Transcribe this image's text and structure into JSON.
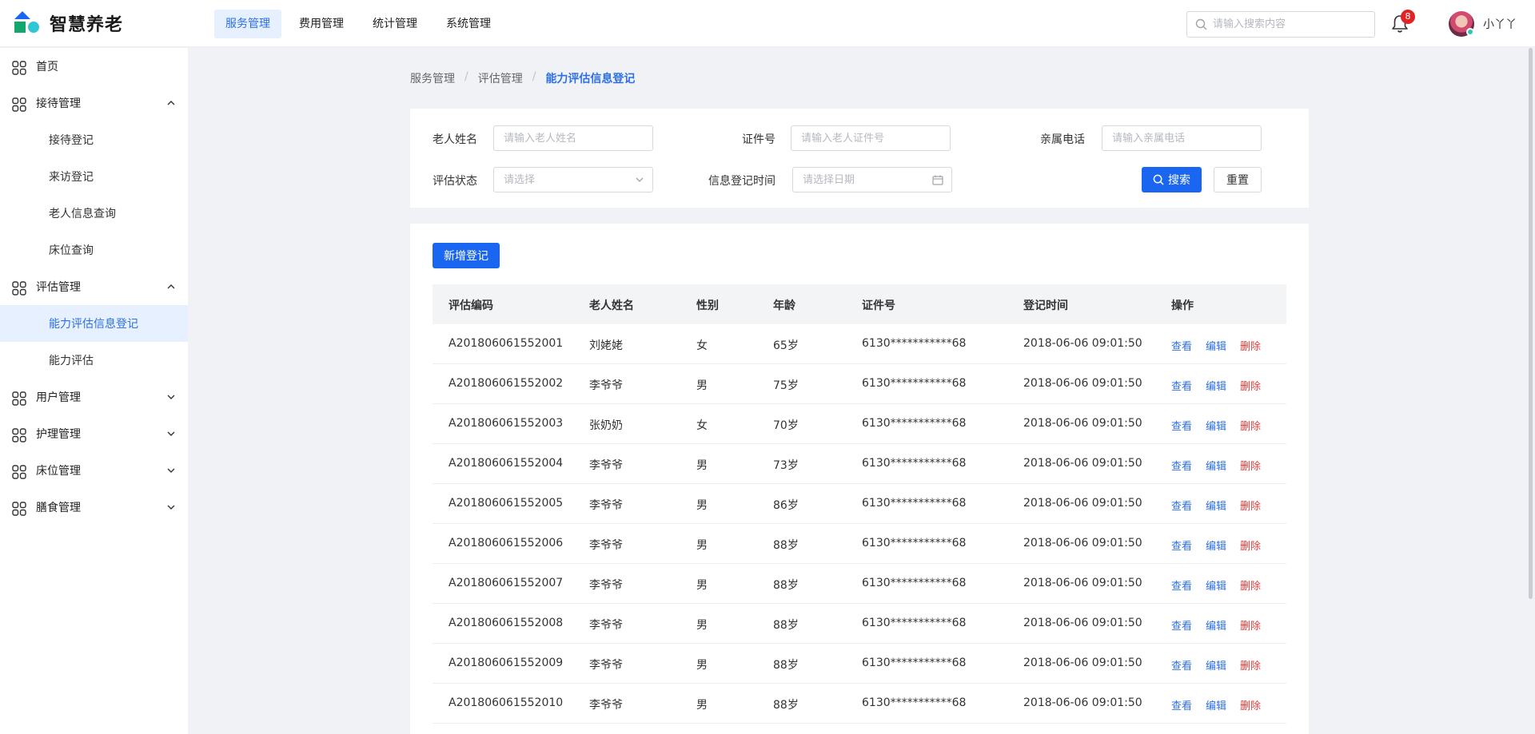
{
  "app": {
    "title": "智慧养老"
  },
  "topnav": [
    {
      "label": "服务管理",
      "active": true
    },
    {
      "label": "费用管理",
      "active": false
    },
    {
      "label": "统计管理",
      "active": false
    },
    {
      "label": "系统管理",
      "active": false
    }
  ],
  "header": {
    "search_placeholder": "请输入搜索内容",
    "notification_count": "8",
    "username": "小丫丫"
  },
  "sidebar": {
    "home": "首页",
    "reception": {
      "label": "接待管理",
      "items": [
        "接待登记",
        "来访登记",
        "老人信息查询",
        "床位查询"
      ]
    },
    "assessment": {
      "label": "评估管理",
      "items": [
        "能力评估信息登记",
        "能力评估"
      ],
      "active_item": "能力评估信息登记"
    },
    "user": "用户管理",
    "nursing": "护理管理",
    "bed": "床位管理",
    "meal": "膳食管理"
  },
  "breadcrumb": [
    "服务管理",
    "评估管理",
    "能力评估信息登记"
  ],
  "filters": {
    "name_label": "老人姓名",
    "name_placeholder": "请输入老人姓名",
    "id_label": "证件号",
    "id_placeholder": "请输入老人证件号",
    "phone_label": "亲属电话",
    "phone_placeholder": "请输入亲属电话",
    "status_label": "评估状态",
    "status_placeholder": "请选择",
    "date_label": "信息登记时间",
    "date_placeholder": "请选择日期",
    "search_button": "搜索",
    "reset_button": "重置"
  },
  "table": {
    "add_button": "新增登记",
    "columns": [
      "评估编码",
      "老人姓名",
      "性别",
      "年龄",
      "证件号",
      "登记时间",
      "操作"
    ],
    "actions": {
      "view": "查看",
      "edit": "编辑",
      "delete": "删除"
    },
    "rows": [
      {
        "code": "A201806061552001",
        "name": "刘姥姥",
        "gender": "女",
        "age": "65岁",
        "id": "6130***********68",
        "time": "2018-06-06 09:01:50"
      },
      {
        "code": "A201806061552002",
        "name": "李爷爷",
        "gender": "男",
        "age": "75岁",
        "id": "6130***********68",
        "time": "2018-06-06 09:01:50"
      },
      {
        "code": "A201806061552003",
        "name": "张奶奶",
        "gender": "女",
        "age": "70岁",
        "id": "6130***********68",
        "time": "2018-06-06 09:01:50"
      },
      {
        "code": "A201806061552004",
        "name": "李爷爷",
        "gender": "男",
        "age": "73岁",
        "id": "6130***********68",
        "time": "2018-06-06 09:01:50"
      },
      {
        "code": "A201806061552005",
        "name": "李爷爷",
        "gender": "男",
        "age": "86岁",
        "id": "6130***********68",
        "time": "2018-06-06 09:01:50"
      },
      {
        "code": "A201806061552006",
        "name": "李爷爷",
        "gender": "男",
        "age": "88岁",
        "id": "6130***********68",
        "time": "2018-06-06 09:01:50"
      },
      {
        "code": "A201806061552007",
        "name": "李爷爷",
        "gender": "男",
        "age": "88岁",
        "id": "6130***********68",
        "time": "2018-06-06 09:01:50"
      },
      {
        "code": "A201806061552008",
        "name": "李爷爷",
        "gender": "男",
        "age": "88岁",
        "id": "6130***********68",
        "time": "2018-06-06 09:01:50"
      },
      {
        "code": "A201806061552009",
        "name": "李爷爷",
        "gender": "男",
        "age": "88岁",
        "id": "6130***********68",
        "time": "2018-06-06 09:01:50"
      },
      {
        "code": "A201806061552010",
        "name": "李爷爷",
        "gender": "男",
        "age": "88岁",
        "id": "6130***********68",
        "time": "2018-06-06 09:01:50"
      }
    ]
  },
  "colors": {
    "primary": "#1a66f0",
    "link": "#2c6fe8",
    "danger": "#e0403e",
    "badge": "#e02424"
  }
}
